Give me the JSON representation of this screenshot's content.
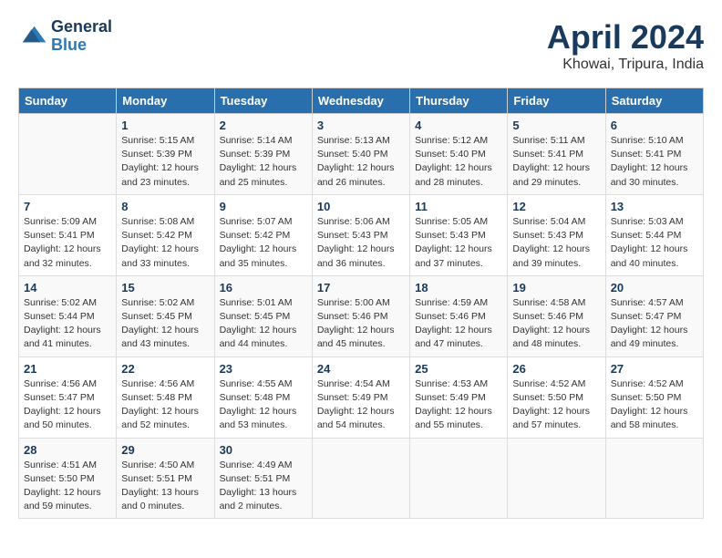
{
  "header": {
    "logo_line1": "General",
    "logo_line2": "Blue",
    "month": "April 2024",
    "location": "Khowai, Tripura, India"
  },
  "weekdays": [
    "Sunday",
    "Monday",
    "Tuesday",
    "Wednesday",
    "Thursday",
    "Friday",
    "Saturday"
  ],
  "weeks": [
    [
      {
        "day": "",
        "info": ""
      },
      {
        "day": "1",
        "info": "Sunrise: 5:15 AM\nSunset: 5:39 PM\nDaylight: 12 hours\nand 23 minutes."
      },
      {
        "day": "2",
        "info": "Sunrise: 5:14 AM\nSunset: 5:39 PM\nDaylight: 12 hours\nand 25 minutes."
      },
      {
        "day": "3",
        "info": "Sunrise: 5:13 AM\nSunset: 5:40 PM\nDaylight: 12 hours\nand 26 minutes."
      },
      {
        "day": "4",
        "info": "Sunrise: 5:12 AM\nSunset: 5:40 PM\nDaylight: 12 hours\nand 28 minutes."
      },
      {
        "day": "5",
        "info": "Sunrise: 5:11 AM\nSunset: 5:41 PM\nDaylight: 12 hours\nand 29 minutes."
      },
      {
        "day": "6",
        "info": "Sunrise: 5:10 AM\nSunset: 5:41 PM\nDaylight: 12 hours\nand 30 minutes."
      }
    ],
    [
      {
        "day": "7",
        "info": "Sunrise: 5:09 AM\nSunset: 5:41 PM\nDaylight: 12 hours\nand 32 minutes."
      },
      {
        "day": "8",
        "info": "Sunrise: 5:08 AM\nSunset: 5:42 PM\nDaylight: 12 hours\nand 33 minutes."
      },
      {
        "day": "9",
        "info": "Sunrise: 5:07 AM\nSunset: 5:42 PM\nDaylight: 12 hours\nand 35 minutes."
      },
      {
        "day": "10",
        "info": "Sunrise: 5:06 AM\nSunset: 5:43 PM\nDaylight: 12 hours\nand 36 minutes."
      },
      {
        "day": "11",
        "info": "Sunrise: 5:05 AM\nSunset: 5:43 PM\nDaylight: 12 hours\nand 37 minutes."
      },
      {
        "day": "12",
        "info": "Sunrise: 5:04 AM\nSunset: 5:43 PM\nDaylight: 12 hours\nand 39 minutes."
      },
      {
        "day": "13",
        "info": "Sunrise: 5:03 AM\nSunset: 5:44 PM\nDaylight: 12 hours\nand 40 minutes."
      }
    ],
    [
      {
        "day": "14",
        "info": "Sunrise: 5:02 AM\nSunset: 5:44 PM\nDaylight: 12 hours\nand 41 minutes."
      },
      {
        "day": "15",
        "info": "Sunrise: 5:02 AM\nSunset: 5:45 PM\nDaylight: 12 hours\nand 43 minutes."
      },
      {
        "day": "16",
        "info": "Sunrise: 5:01 AM\nSunset: 5:45 PM\nDaylight: 12 hours\nand 44 minutes."
      },
      {
        "day": "17",
        "info": "Sunrise: 5:00 AM\nSunset: 5:46 PM\nDaylight: 12 hours\nand 45 minutes."
      },
      {
        "day": "18",
        "info": "Sunrise: 4:59 AM\nSunset: 5:46 PM\nDaylight: 12 hours\nand 47 minutes."
      },
      {
        "day": "19",
        "info": "Sunrise: 4:58 AM\nSunset: 5:46 PM\nDaylight: 12 hours\nand 48 minutes."
      },
      {
        "day": "20",
        "info": "Sunrise: 4:57 AM\nSunset: 5:47 PM\nDaylight: 12 hours\nand 49 minutes."
      }
    ],
    [
      {
        "day": "21",
        "info": "Sunrise: 4:56 AM\nSunset: 5:47 PM\nDaylight: 12 hours\nand 50 minutes."
      },
      {
        "day": "22",
        "info": "Sunrise: 4:56 AM\nSunset: 5:48 PM\nDaylight: 12 hours\nand 52 minutes."
      },
      {
        "day": "23",
        "info": "Sunrise: 4:55 AM\nSunset: 5:48 PM\nDaylight: 12 hours\nand 53 minutes."
      },
      {
        "day": "24",
        "info": "Sunrise: 4:54 AM\nSunset: 5:49 PM\nDaylight: 12 hours\nand 54 minutes."
      },
      {
        "day": "25",
        "info": "Sunrise: 4:53 AM\nSunset: 5:49 PM\nDaylight: 12 hours\nand 55 minutes."
      },
      {
        "day": "26",
        "info": "Sunrise: 4:52 AM\nSunset: 5:50 PM\nDaylight: 12 hours\nand 57 minutes."
      },
      {
        "day": "27",
        "info": "Sunrise: 4:52 AM\nSunset: 5:50 PM\nDaylight: 12 hours\nand 58 minutes."
      }
    ],
    [
      {
        "day": "28",
        "info": "Sunrise: 4:51 AM\nSunset: 5:50 PM\nDaylight: 12 hours\nand 59 minutes."
      },
      {
        "day": "29",
        "info": "Sunrise: 4:50 AM\nSunset: 5:51 PM\nDaylight: 13 hours\nand 0 minutes."
      },
      {
        "day": "30",
        "info": "Sunrise: 4:49 AM\nSunset: 5:51 PM\nDaylight: 13 hours\nand 2 minutes."
      },
      {
        "day": "",
        "info": ""
      },
      {
        "day": "",
        "info": ""
      },
      {
        "day": "",
        "info": ""
      },
      {
        "day": "",
        "info": ""
      }
    ]
  ]
}
